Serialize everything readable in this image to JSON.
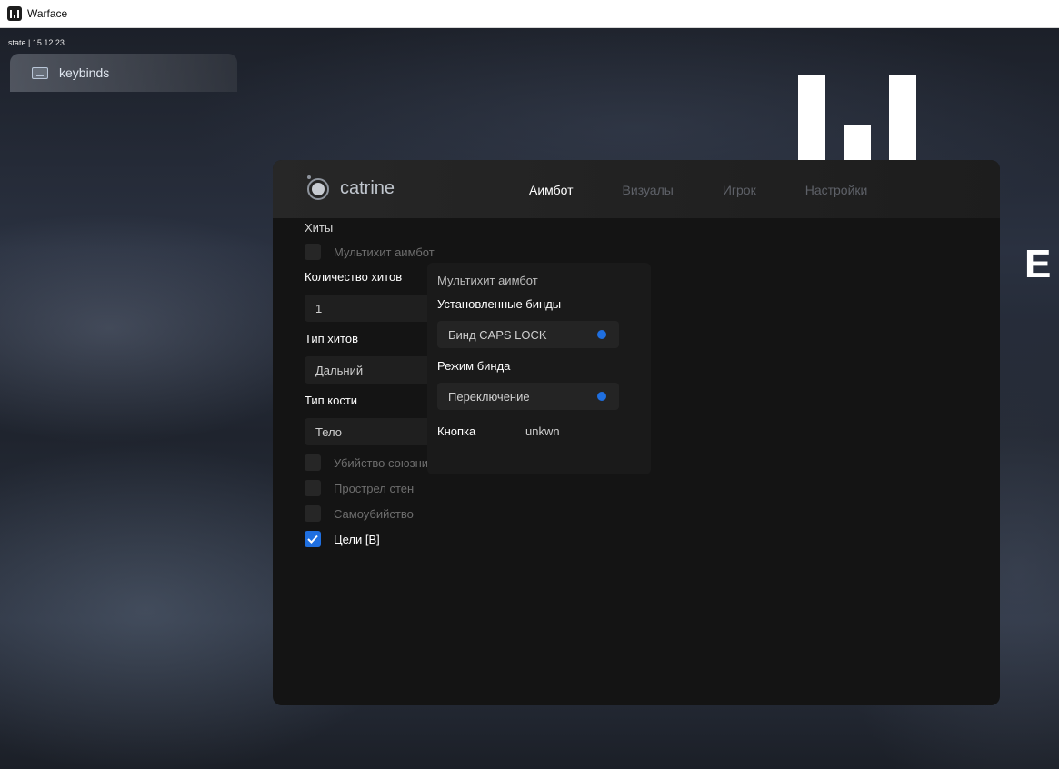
{
  "window": {
    "title": "Warface"
  },
  "overlay": {
    "state_label": "state | 15.12.23",
    "keybinds_tab": {
      "icon": "keyboard-icon",
      "label": "keybinds"
    }
  },
  "background": {
    "logo_letter": "E"
  },
  "panel": {
    "brand": {
      "name": "catrine",
      "icon": "catrine-logo-icon"
    },
    "tabs": [
      {
        "label": "Аимбот",
        "active": true
      },
      {
        "label": "Визуалы",
        "active": false
      },
      {
        "label": "Игрок",
        "active": false
      },
      {
        "label": "Настройки",
        "active": false
      }
    ],
    "settings": {
      "hits_header": "Хиты",
      "multihit_checkbox": {
        "label": "Мультихит аимбот",
        "checked": false
      },
      "hit_count": {
        "label": "Количество хитов",
        "value": "1"
      },
      "hit_type": {
        "label": "Тип хитов",
        "value": "Дальний"
      },
      "bone_type": {
        "label": "Тип кости",
        "value": "Тело"
      },
      "checkboxes": [
        {
          "label": "Убийство союзни",
          "checked": false
        },
        {
          "label": "Прострел стен",
          "checked": false
        },
        {
          "label": "Самоубийство",
          "checked": false
        },
        {
          "label": "Цели [B]",
          "checked": true
        }
      ]
    },
    "popup": {
      "title": "Мультихит аимбот",
      "installed_binds_label": "Установленные бинды",
      "bind_select": "Бинд CAPS LOCK",
      "bind_mode_label": "Режим бинда",
      "bind_mode_select": "Переключение",
      "button_label": "Кнопка",
      "button_value": "unkwn"
    }
  },
  "colors": {
    "accent": "#1f6fe0",
    "panel_bg": "#141414",
    "tab_inactive": "#5e6168"
  }
}
